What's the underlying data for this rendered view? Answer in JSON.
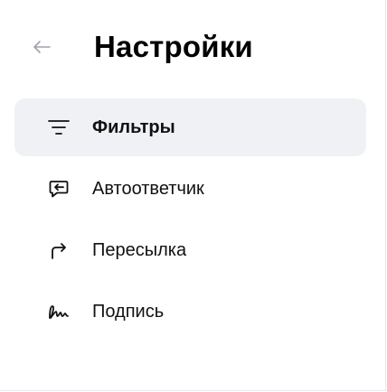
{
  "header": {
    "title": "Настройки",
    "back_icon": "arrow-left-icon"
  },
  "menu": {
    "items": [
      {
        "label": "Фильтры",
        "icon": "filter-lines-icon",
        "active": true
      },
      {
        "label": "Автоответчик",
        "icon": "auto-reply-icon",
        "active": false
      },
      {
        "label": "Пересылка",
        "icon": "forward-arrow-icon",
        "active": false
      },
      {
        "label": "Подпись",
        "icon": "signature-icon",
        "active": false
      }
    ]
  },
  "colors": {
    "active_background": "#f0f1f5",
    "text": "#111111",
    "muted_icon": "#9ea3ab"
  }
}
